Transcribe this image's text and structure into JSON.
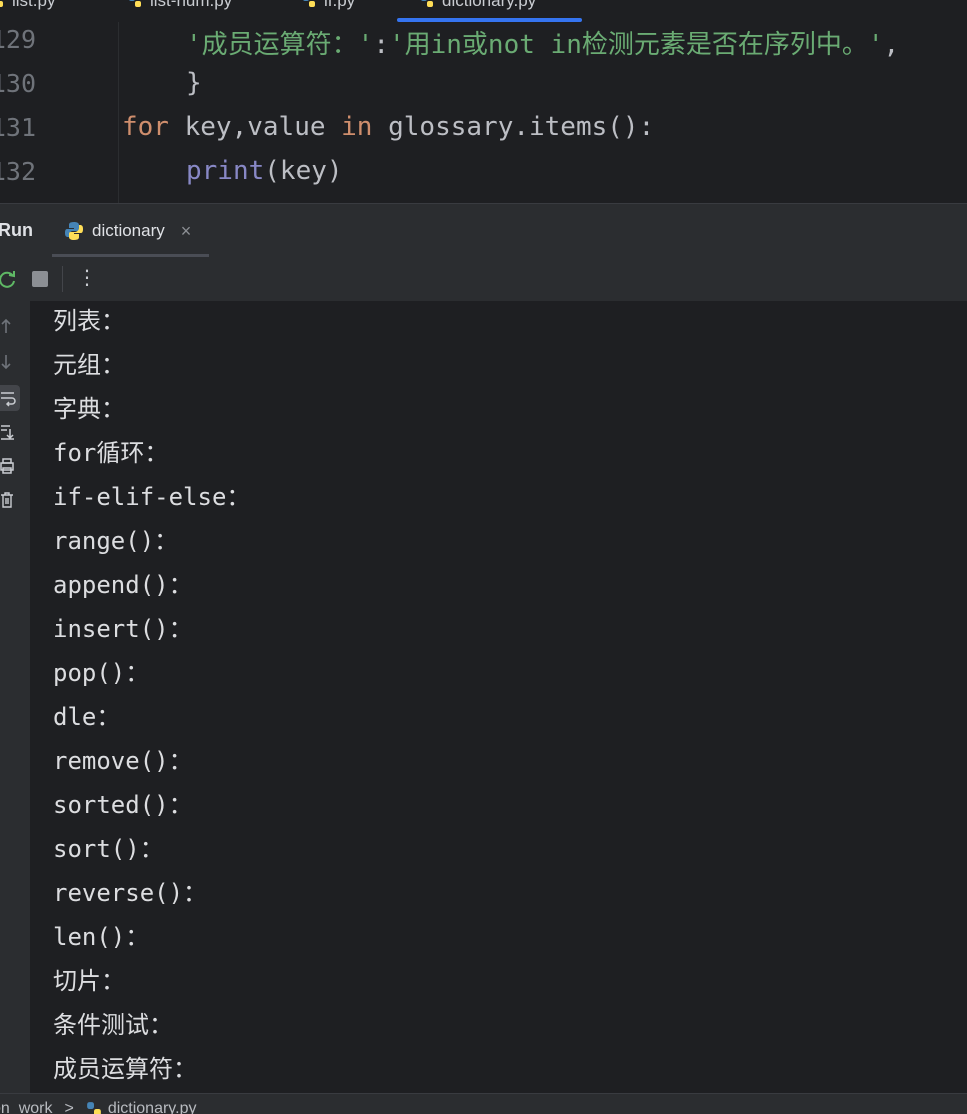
{
  "editor_tabs": [
    {
      "label": "list.py"
    },
    {
      "label": "list-num.py"
    },
    {
      "label": "if.py"
    },
    {
      "label": "dictionary.py"
    }
  ],
  "editor": {
    "lines": [
      {
        "number": "129",
        "text_parts": [
          "'成员运算符：'",
          ":",
          "'用in或not in检测元素是否在序列中。'",
          ","
        ]
      },
      {
        "number": "130",
        "text": "}"
      },
      {
        "number": "131",
        "keyword_for": "for",
        "vars": " key,value ",
        "keyword_in": "in",
        "rest": " glossary.items():"
      },
      {
        "number": "132",
        "builtin": "print",
        "rest": "(key)"
      }
    ]
  },
  "run_panel": {
    "title": "Run",
    "tab_label": "dictionary",
    "close_glyph": "×"
  },
  "toolbar": {
    "rerun_icon": "rerun-icon",
    "stop_icon": "stop-icon",
    "more_glyph": "⋮"
  },
  "console_output": [
    "列表：",
    "元组：",
    "字典：",
    "for循环：",
    "if-elif-else：",
    "range()：",
    "append()：",
    "insert()：",
    "pop()：",
    "dle：",
    "remove()：",
    "sorted()：",
    "sort()：",
    "reverse()：",
    "len()：",
    "切片：",
    "条件测试：",
    "成员运算符："
  ],
  "status_bar": {
    "crumb_1": "on_work",
    "separator": ">",
    "crumb_2": "dictionary.py"
  },
  "colors": {
    "background": "#1e1f22",
    "panel": "#2b2d30",
    "keyword": "#cf8e6d",
    "string": "#6aab73",
    "builtin": "#8888c6",
    "accent": "#3574f0"
  }
}
